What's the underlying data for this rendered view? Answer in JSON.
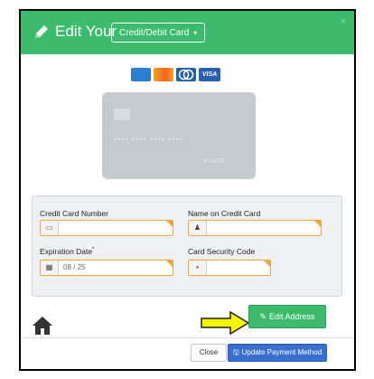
{
  "header": {
    "title": "Edit Your",
    "select_value": "Credit/Debit Card",
    "close_glyph": "×",
    "color": "#3dbb6c"
  },
  "brands": [
    "amex-icon",
    "discover-icon",
    "diners-club-icon",
    "visa-icon"
  ],
  "brand_visa_text": "VISA",
  "card_preview": {
    "number_mask": "•••• •••• •••• ••••",
    "expiry": "08/25"
  },
  "form": {
    "card_number": {
      "label": "Credit Card Number",
      "value": ""
    },
    "name_on_card": {
      "label": "Name on Credit Card",
      "value": ""
    },
    "expiration_date": {
      "label": "Expiration Date",
      "required_mark": "*",
      "value": "08 / 25"
    },
    "security_code": {
      "label": "Card Security Code",
      "value": ""
    }
  },
  "edit_address_button": "Edit Address",
  "footer": {
    "close_label": "Close",
    "update_label": "Update Payment Method"
  },
  "colors": {
    "accent_green": "#3dbb6c",
    "field_border": "#f0a540",
    "primary_blue": "#3a6fd1",
    "arrow_yellow": "#f5f500"
  }
}
